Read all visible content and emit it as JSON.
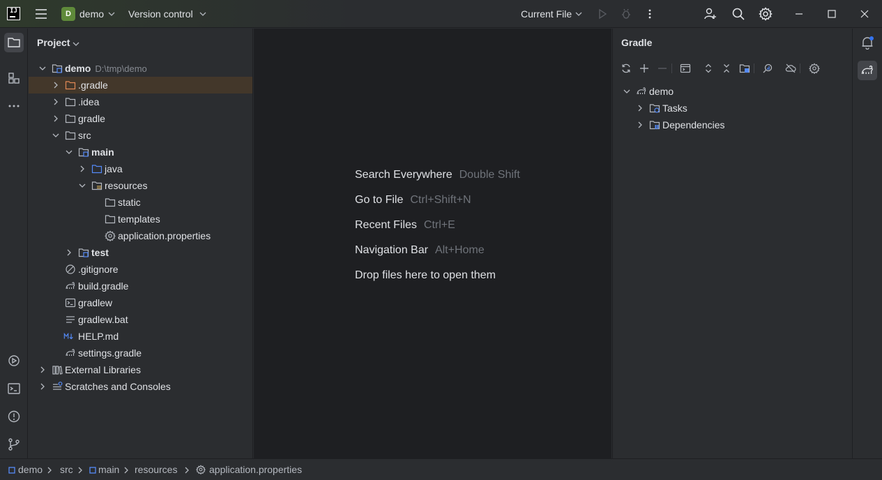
{
  "titlebar": {
    "logo_text": "IJ",
    "project_badge": "D",
    "project_name": "demo",
    "vcs_label": "Version control",
    "run_config": "Current File"
  },
  "project_panel": {
    "title": "Project",
    "tree": [
      {
        "label": "demo",
        "hint": "D:\\tmp\\demo"
      },
      {
        "label": ".gradle"
      },
      {
        "label": ".idea"
      },
      {
        "label": "gradle"
      },
      {
        "label": "src"
      },
      {
        "label": "main"
      },
      {
        "label": "java"
      },
      {
        "label": "resources"
      },
      {
        "label": "static"
      },
      {
        "label": "templates"
      },
      {
        "label": "application.properties"
      },
      {
        "label": "test"
      },
      {
        "label": ".gitignore"
      },
      {
        "label": "build.gradle"
      },
      {
        "label": "gradlew"
      },
      {
        "label": "gradlew.bat"
      },
      {
        "label": "HELP.md"
      },
      {
        "label": "settings.gradle"
      },
      {
        "label": "External Libraries"
      },
      {
        "label": "Scratches and Consoles"
      }
    ]
  },
  "editor": {
    "hints": [
      {
        "action": "Search Everywhere",
        "key": "Double Shift"
      },
      {
        "action": "Go to File",
        "key": "Ctrl+Shift+N"
      },
      {
        "action": "Recent Files",
        "key": "Ctrl+E"
      },
      {
        "action": "Navigation Bar",
        "key": "Alt+Home"
      },
      {
        "action": "Drop files here to open them",
        "key": ""
      }
    ]
  },
  "gradle_panel": {
    "title": "Gradle",
    "tree": [
      {
        "label": "demo"
      },
      {
        "label": "Tasks"
      },
      {
        "label": "Dependencies"
      }
    ]
  },
  "statusbar": {
    "breadcrumbs": [
      "demo",
      "src",
      "main",
      "resources",
      "application.properties"
    ]
  },
  "colors": {
    "accent": "#3574f0",
    "selection": "#43372a",
    "folder_module": "#548af7"
  }
}
